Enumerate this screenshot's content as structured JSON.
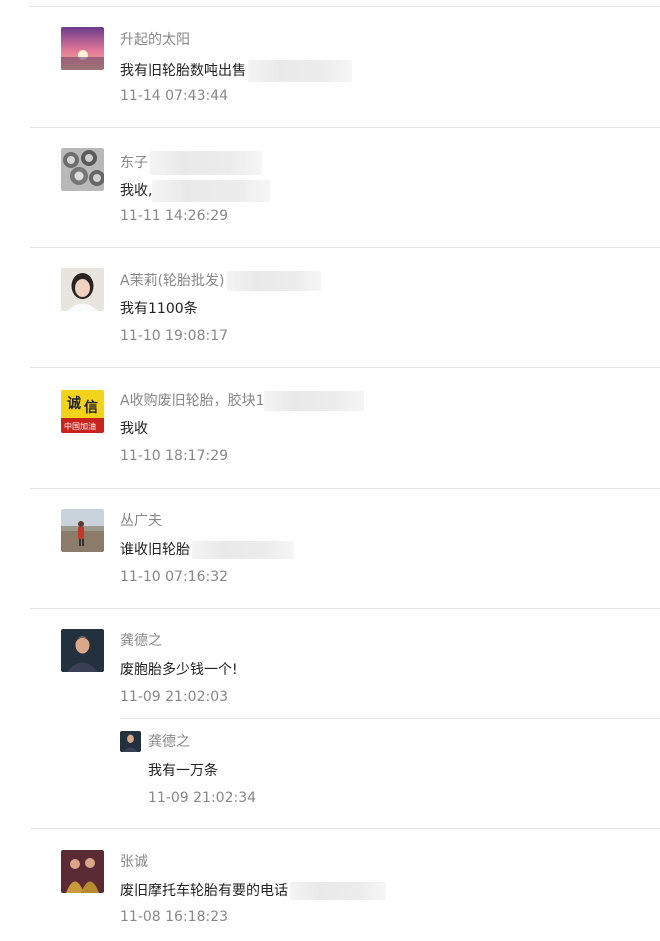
{
  "comments": [
    {
      "name": "升起的太阳",
      "message": "我有旧轮胎数吨出售",
      "time": "11-14 07:43:44",
      "avatar": "sunrise-avatar"
    },
    {
      "name": "东子",
      "message": "我收,",
      "time": "11-11 14:26:29",
      "avatar": "tire-pile-avatar"
    },
    {
      "name": "A茉莉(轮胎批发)",
      "message": "我有1100条",
      "time": "11-10 19:08:17",
      "avatar": "woman-avatar"
    },
    {
      "name": "A收购废旧轮胎，胶块1",
      "message": "我收",
      "time": "11-10 18:17:29",
      "avatar": "integrity-sign-avatar",
      "avatar_text": [
        "诚",
        "信",
        "中国加油"
      ]
    },
    {
      "name": "丛广夫",
      "message": "谁收旧轮胎",
      "time": "11-10 07:16:32",
      "avatar": "landscape-person-avatar"
    },
    {
      "name": "龚德之",
      "message": "废胞胎多少钱一个!",
      "time": "11-09 21:02:03",
      "avatar": "man-portrait-avatar",
      "reply": {
        "name": "龚德之",
        "message": "我有一万条",
        "time": "11-09 21:02:34",
        "avatar": "man-portrait-avatar"
      }
    },
    {
      "name": "张诚",
      "message": "废旧摩托车轮胎有要的电话",
      "time": "11-08 16:18:23",
      "avatar": "two-people-avatar"
    }
  ],
  "colors": {
    "name": "#888888",
    "message": "#222222",
    "divider": "#e5e5e5",
    "redaction": "#ececec"
  }
}
